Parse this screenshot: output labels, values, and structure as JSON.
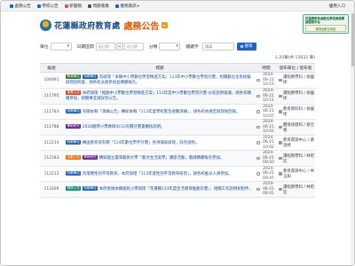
{
  "topnav": {
    "items": [
      {
        "label": "處務公告",
        "icon": "megaphone-icon",
        "color": "#1e63c7"
      },
      {
        "label": "學校公告",
        "icon": "school-icon",
        "color": "#1e63c7"
      },
      {
        "label": "新聞稿",
        "icon": "news-icon",
        "color": "#d9534f"
      },
      {
        "label": "問題蒐集",
        "icon": "question-icon",
        "color": "#555555"
      },
      {
        "label": "服務資訊",
        "icon": "info-icon",
        "color": "#1e63c7"
      }
    ],
    "login_label": "優用入口"
  },
  "header": {
    "org": "花蓮縣政府教育處",
    "title": "處務公告",
    "badge_line1": "花蓮縣教育處數位學習資源網路服務平台",
    "badge_line2": "教育處數位系統"
  },
  "filters": {
    "unit_label": "單位",
    "date_label": "日期區間",
    "start_placeholder": "起日期",
    "separator": "~",
    "end_placeholder": "迄日期",
    "category_label": "分類",
    "keyword_label": "關鍵字",
    "keyword_placeholder": "請填",
    "search_label": "搜尋"
  },
  "pager": {
    "text": "1-20筆(共 15632 筆)"
  },
  "table": {
    "headers": [
      "編號",
      "標題",
      "時間",
      "發布單位 / 發布者"
    ],
    "rows": [
      {
        "no": "106991",
        "tags": [
          {
            "label": "教育單位",
            "color": "#2e7d32"
          },
          {
            "label": "特教單位",
            "color": "#1565c0"
          }
        ],
        "title": "為辦理「本縣中小學數位學習精進方案」113年中小學數位學習計畫，相關數位化系統擬辦理說明會，請各校派員參加並踴躍報名。",
        "date": "2024-06-21 10:15",
        "unit": "課程教學科 / 翁優修"
      },
      {
        "no": "111795",
        "tags": [
          {
            "label": "重要公告",
            "color": "#d84315"
          }
        ],
        "title": "本府辦理「推動中小學數位學習精進方案」113年度中小學數位學習計畫-分區說明會議，請各校踴躍參加，相關事宜請詳見公告。",
        "date": "2024-06-21 10:11",
        "unit": "課程教學科 / 翁優修"
      },
      {
        "no": "111783",
        "tags": [
          {
            "label": "特教單位",
            "color": "#1565c0"
          }
        ],
        "title": "有關本縣「演練公告」轉知本縣「113年度學校緊急避難演練」，請各校依規定辦理後回報。",
        "date": "2024-06-21 10:07",
        "unit": "教育資料科 / 翁優修"
      },
      {
        "no": "111788",
        "tags": [
          {
            "label": "學術研究",
            "color": "#6a1b9a"
          }
        ],
        "title": "2028國際小學教師(ICG)有關計畫書審核說明。",
        "date": "2024-06-21 10:01",
        "unit": "體育保健科 / 蔡亞春"
      },
      {
        "no": "112214",
        "tags": [
          {
            "label": "特教單位",
            "color": "#1565c0"
          }
        ],
        "title": "轉送教育部有關「114年數位學伴計畫」各項補助辦理，詳見說明。",
        "date": "2024-06-21 10:02",
        "unit": "教育資源中心 / 黃淑婷"
      },
      {
        "no": "112183",
        "tags": [
          {
            "label": "活動公告",
            "color": "#ef6c00"
          },
          {
            "label": "學術研究",
            "color": "#6a1b9a"
          }
        ],
        "title": "轉知國立臺灣藝術大學「藝文生活美學」講座活動，敬請踴躍報名參加。",
        "date": "2024-06-21 09:50",
        "unit": "課程教學科 / 林昭宏"
      },
      {
        "no": "112212",
        "tags": [
          {
            "label": "特教單位",
            "color": "#1565c0"
          }
        ],
        "title": "為落實性別平等教育，本府辦理「113年度性別平等教育研習」，請各校推派人員參加。",
        "date": "2024-06-21 09:47",
        "unit": "教育資源中心 / 林玉如"
      },
      {
        "no": "112209",
        "tags": [
          {
            "label": "預算公告",
            "color": "#00897b"
          },
          {
            "label": "特教單位",
            "color": "#1565c0"
          }
        ],
        "title": "本府委請本縣國民小學辦理「花蓮縣113年度生活教育推動計畫」，相關工作說明如附件。",
        "date": "2024-06-21 09:41",
        "unit": "課程教學科 / 林昭宏"
      }
    ]
  }
}
